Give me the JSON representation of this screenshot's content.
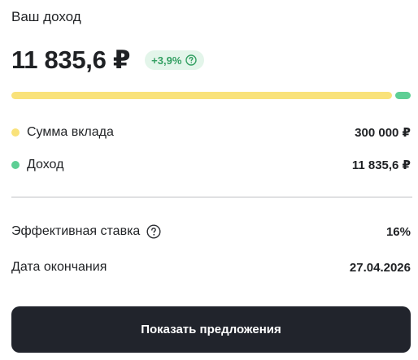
{
  "header": {
    "title": "Ваш доход",
    "amount": "11 835,6 ₽",
    "growth_badge": "+3,9%",
    "badge_icon": "question-circle-icon"
  },
  "progress": {
    "deposit_fraction": 0.962,
    "income_fraction": 0.038,
    "deposit_color": "#f9e27a",
    "income_color": "#5ecf95"
  },
  "breakdown": [
    {
      "label": "Сумма вклада",
      "value": "300 000 ₽",
      "color": "#f9e27a"
    },
    {
      "label": "Доход",
      "value": "11 835,6 ₽",
      "color": "#5ecf95"
    }
  ],
  "details": {
    "rate_label": "Эффективная ставка",
    "rate_value": "16%",
    "rate_icon": "question-circle-icon",
    "end_label": "Дата окончания",
    "end_value": "27.04.2026"
  },
  "cta": {
    "label": "Показать предложения",
    "background": "#21242c"
  }
}
